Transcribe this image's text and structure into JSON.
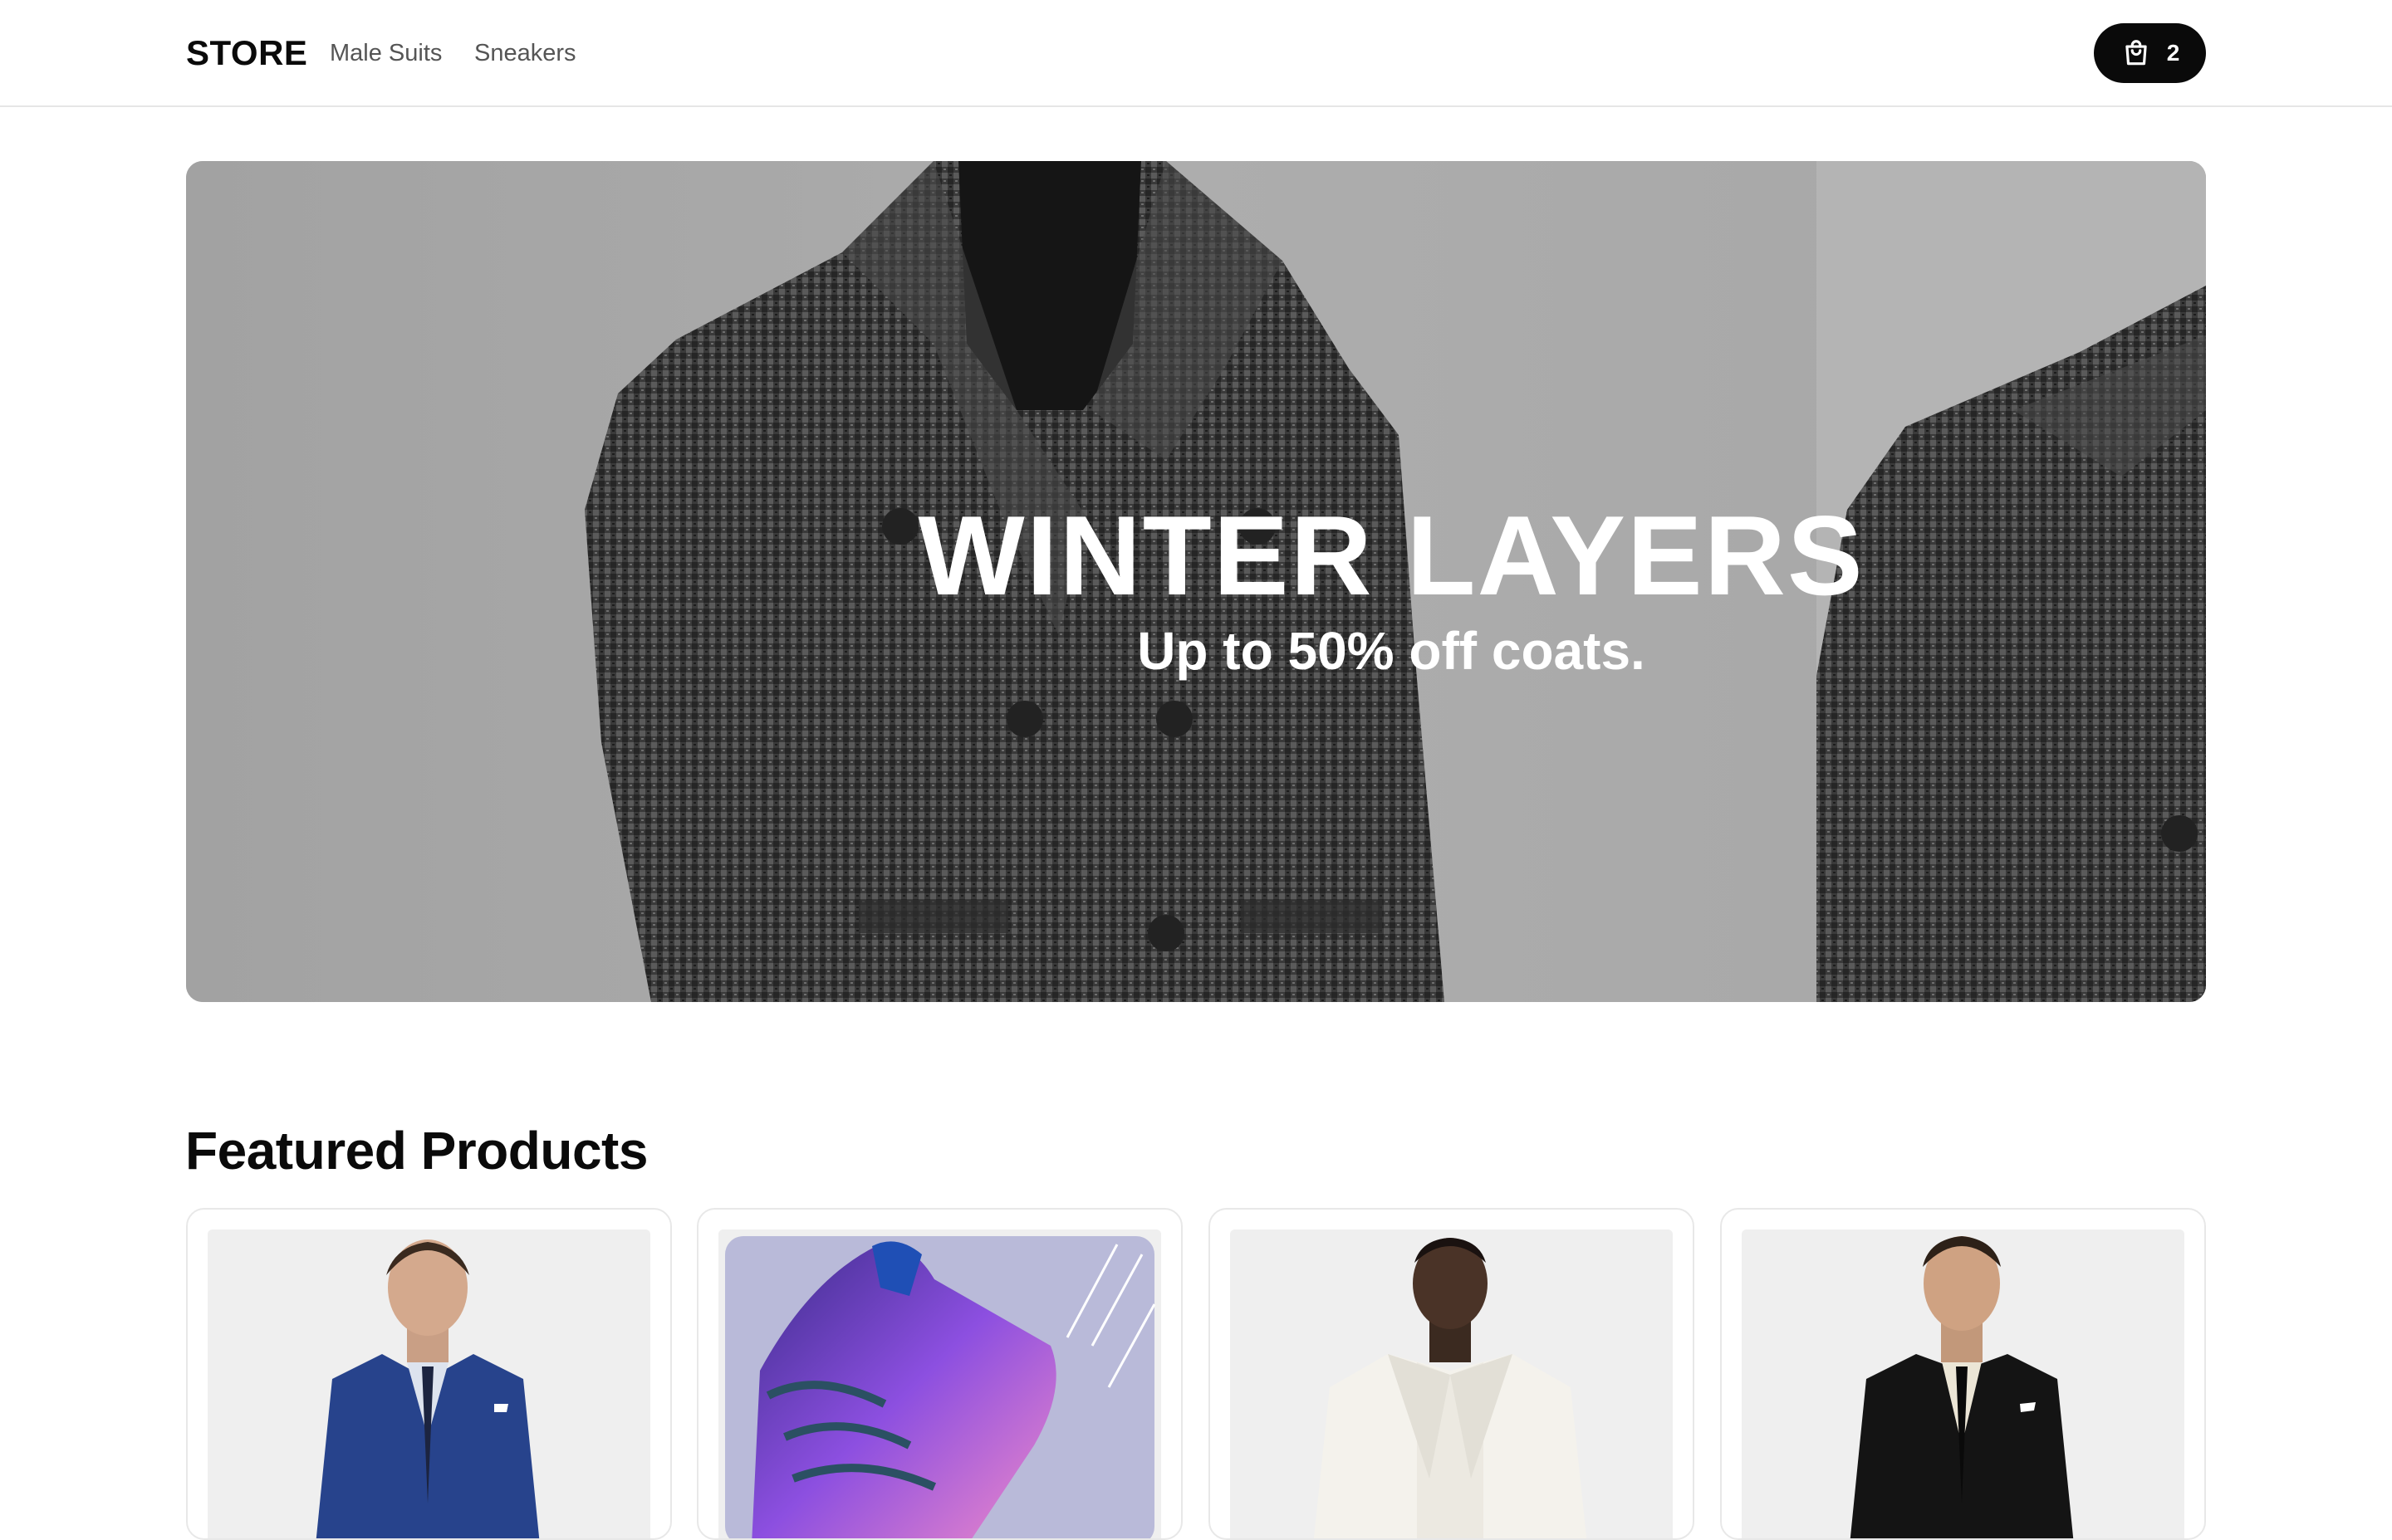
{
  "header": {
    "logo": "STORE",
    "nav": [
      {
        "label": "Male Suits"
      },
      {
        "label": "Sneakers"
      }
    ],
    "cart": {
      "icon": "shopping-bag-icon",
      "count": "2"
    }
  },
  "hero": {
    "title": "WINTER LAYERS",
    "subtitle": "Up to 50% off coats."
  },
  "featured": {
    "title": "Featured Products",
    "products": [
      {
        "image": "blue-suit-image"
      },
      {
        "image": "purple-sneaker-image"
      },
      {
        "image": "white-suit-image"
      },
      {
        "image": "black-suit-image"
      }
    ]
  },
  "colors": {
    "accent": "#0a0a0a",
    "card_border": "#e8e8e8",
    "thumb_bg": "#efefef"
  }
}
